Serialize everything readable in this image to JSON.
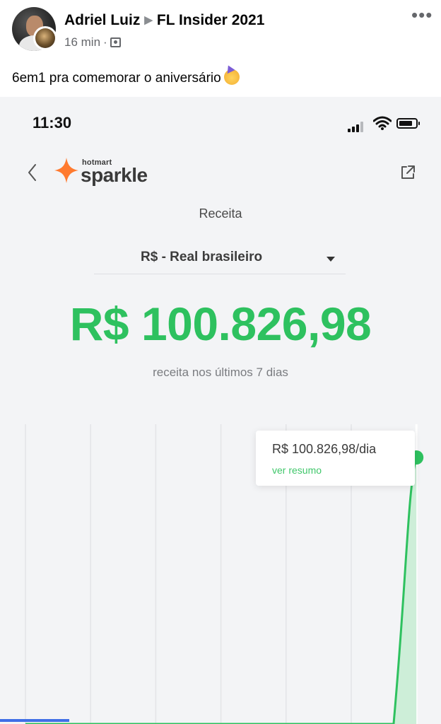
{
  "post": {
    "author": "Adriel Luiz",
    "group": "FL Insider 2021",
    "time": "16 min",
    "separator": "·",
    "text": "6em1 pra comemorar o aniversário",
    "emoji": "partying-face-emoji",
    "more_label": "•••"
  },
  "phone": {
    "status_time": "11:30"
  },
  "app": {
    "brand_small": "hotmart",
    "brand_big": "sparkle",
    "brand_color": "#ff7a2f",
    "accent_color": "#2ec15f",
    "section_title": "Receita",
    "currency_selected": "R$ - Real brasileiro",
    "revenue_amount": "R$ 100.826,98",
    "revenue_caption": "receita nos últimos 7 dias",
    "tooltip_value": "R$ 100.826,98/dia",
    "tooltip_link": "ver resumo"
  },
  "chart_data": {
    "type": "area",
    "series": [
      {
        "values": [
          0,
          0,
          0,
          0,
          0,
          0,
          100826.98
        ]
      }
    ],
    "highlighted_value": "R$ 100.826,98/dia",
    "grid": true
  }
}
